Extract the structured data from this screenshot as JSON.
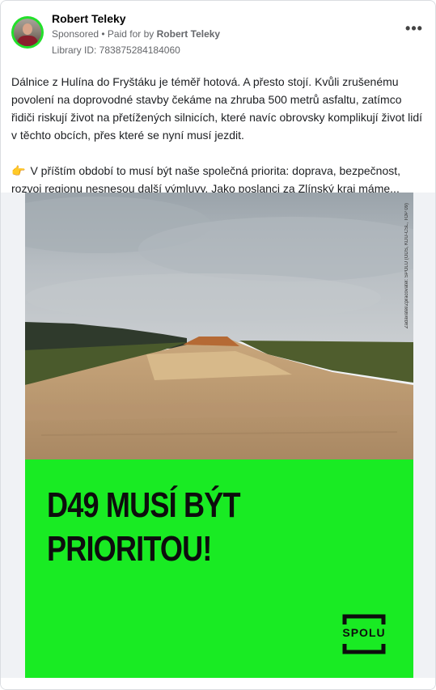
{
  "post": {
    "author": "Robert Teleky",
    "sponsored": "Sponsored",
    "paid_prefix": " • Paid for by ",
    "paid_by": "Robert Teleky",
    "library_id": "Library ID: 783875284184060",
    "more_icon": "more-horizontal-icon",
    "paragraph1": "Dálnice z Hulína do Fryštáku je téměř hotová. A přesto stojí. Kvůli zrušenému povolení na doprovodné stavby čekáme na zhruba 500 metrů asfaltu, zatímco řidiči riskují život na přetížených silnicích, které navíc obrovsky komplikují život lidí v těchto obcích, přes které se nyní musí jezdit.",
    "paragraph2_emoji": "👉",
    "paragraph2": "V příštím období to musí být naše společná priorita: doprava, bezpečnost, rozvoj regionu nesnesou další výmluvy. Jako poslanci za Zlínský kraj máme..."
  },
  "creative": {
    "headline_line1": "D49 MUSÍ BÝT",
    "headline_line2": "PRIORITOU!",
    "logo_text": "SPOLU",
    "side_note": "Zadavatel/Zpracovatel: SPOLU (ODS, KDU-ČSL, TOP 09)",
    "green_color": "#19eb23"
  }
}
